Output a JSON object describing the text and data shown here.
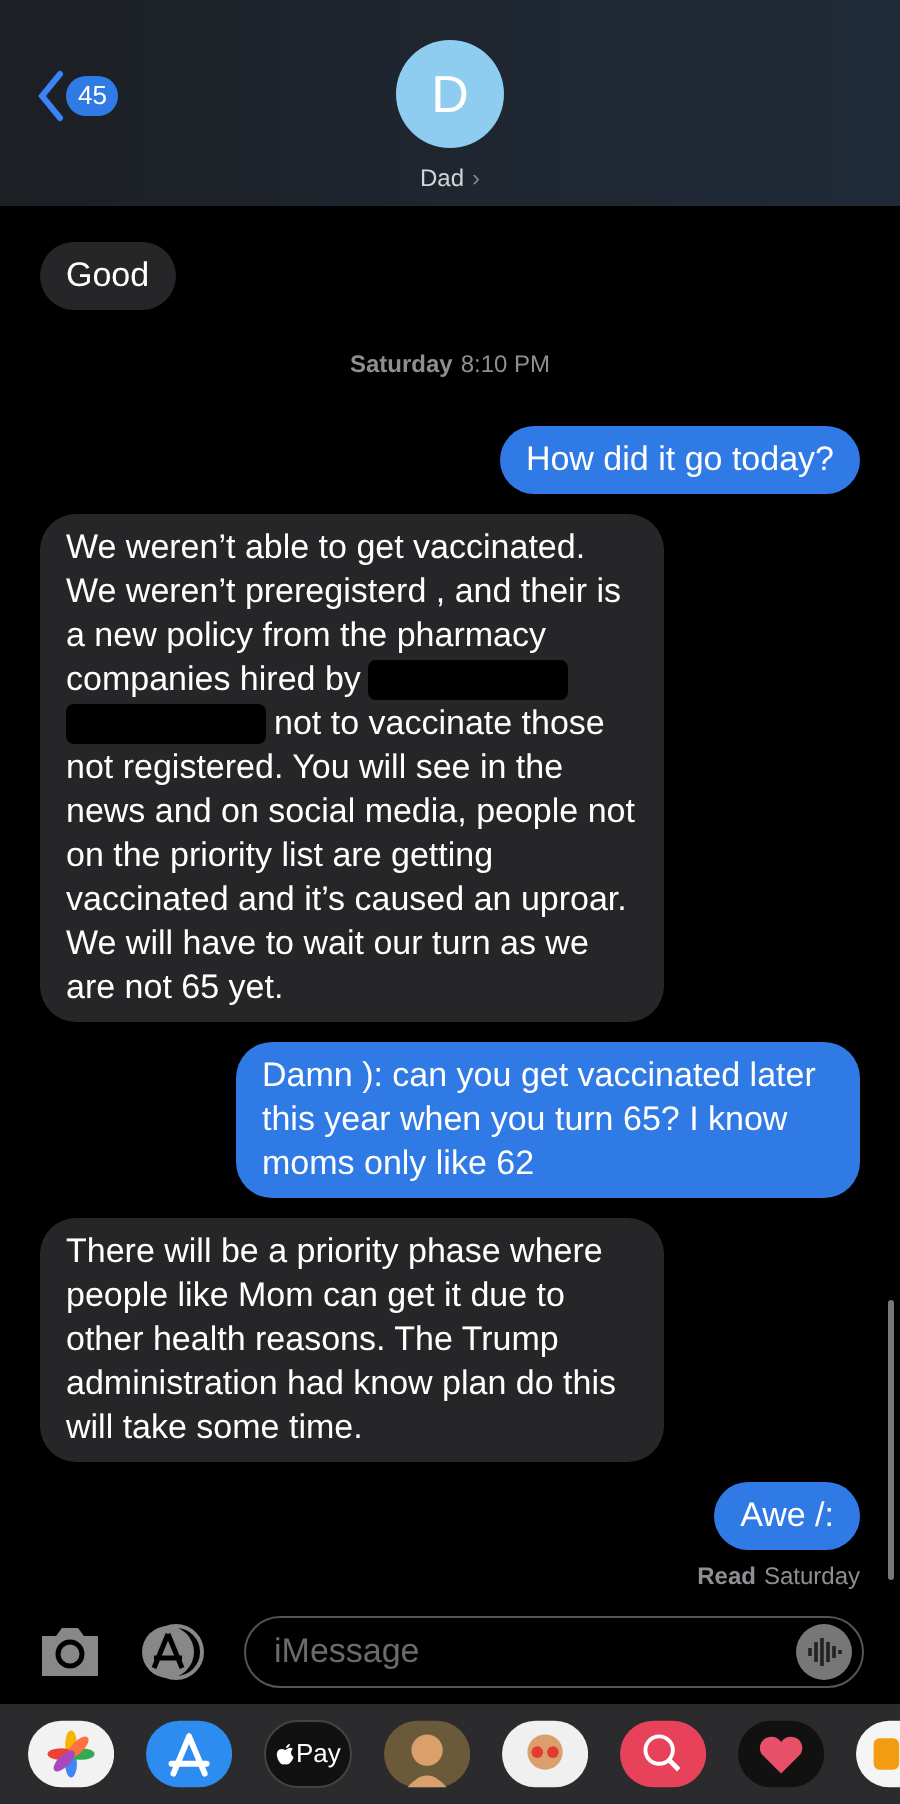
{
  "header": {
    "back_count": "45",
    "avatar_initial": "D",
    "contact_name": "Dad",
    "chevron": "›"
  },
  "messages": [
    {
      "kind": "incoming",
      "segments": [
        {
          "kind": "text",
          "text": "Good"
        }
      ]
    },
    {
      "kind": "timestamp",
      "day": "Saturday",
      "time": "8:10 PM"
    },
    {
      "kind": "outgoing",
      "segments": [
        {
          "kind": "text",
          "text": "How did it go today?"
        }
      ]
    },
    {
      "kind": "incoming",
      "segments": [
        {
          "kind": "text",
          "text": "We weren’t able to get vaccinated. We weren’t preregisterd , and their is a new policy from the pharmacy"
        },
        {
          "kind": "row",
          "parts": [
            {
              "kind": "text",
              "text": "companies hired by"
            },
            {
              "kind": "redaction"
            }
          ]
        },
        {
          "kind": "row",
          "parts": [
            {
              "kind": "redaction"
            },
            {
              "kind": "text",
              "text": "not to vaccinate those"
            }
          ]
        },
        {
          "kind": "text",
          "text": "not registered. You will see in the news and on social media, people not on the priority list are getting vaccinated and it’s caused an uproar. We will have to wait our turn as we are not 65 yet."
        }
      ]
    },
    {
      "kind": "outgoing",
      "segments": [
        {
          "kind": "text",
          "text": "Damn ): can you get vaccinated later this year when you turn 65? I know moms only like 62"
        }
      ]
    },
    {
      "kind": "incoming",
      "segments": [
        {
          "kind": "text",
          "text": "There will be a priority phase where people like Mom can get it due to other health reasons. The Trump administration had know plan do this will take some time."
        }
      ]
    },
    {
      "kind": "outgoing",
      "segments": [
        {
          "kind": "text",
          "text": "Awe /:"
        }
      ]
    },
    {
      "kind": "receipt",
      "label": "Read",
      "when": "Saturday"
    }
  ],
  "composer": {
    "placeholder": "iMessage"
  },
  "app_drawer": [
    {
      "kind": "photos"
    },
    {
      "kind": "appstore"
    },
    {
      "kind": "applepay",
      "label": "Pay"
    },
    {
      "kind": "memoji"
    },
    {
      "kind": "stickers"
    },
    {
      "kind": "search"
    },
    {
      "kind": "heart"
    },
    {
      "kind": "partial"
    }
  ]
}
